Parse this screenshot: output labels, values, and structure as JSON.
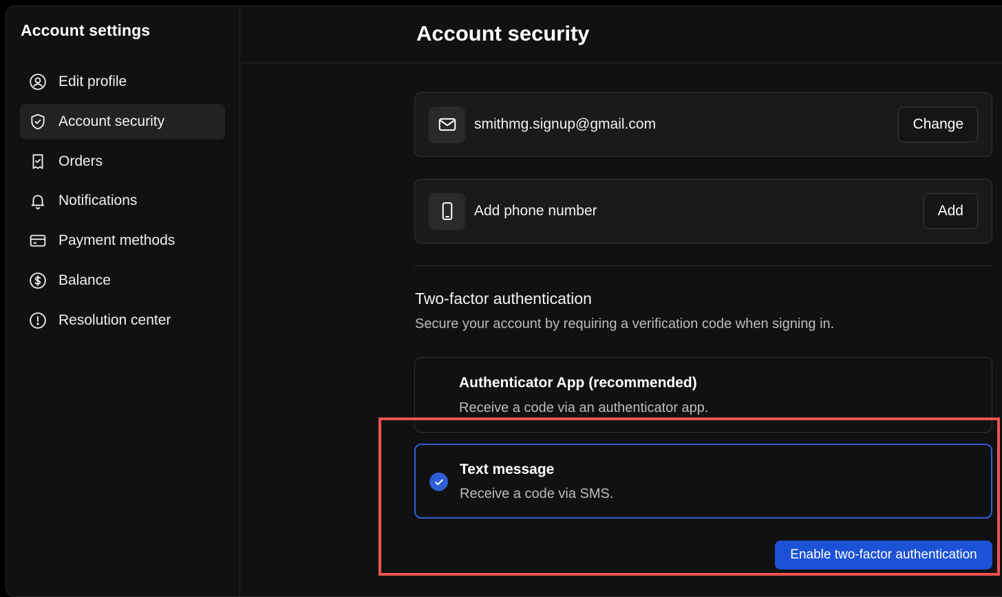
{
  "sidebar": {
    "title": "Account settings",
    "items": [
      {
        "label": "Edit profile",
        "icon": "user-circle-icon",
        "active": false
      },
      {
        "label": "Account security",
        "icon": "shield-icon",
        "active": true
      },
      {
        "label": "Orders",
        "icon": "receipt-icon",
        "active": false
      },
      {
        "label": "Notifications",
        "icon": "bell-icon",
        "active": false
      },
      {
        "label": "Payment methods",
        "icon": "credit-card-icon",
        "active": false
      },
      {
        "label": "Balance",
        "icon": "dollar-circle-icon",
        "active": false
      },
      {
        "label": "Resolution center",
        "icon": "alert-circle-icon",
        "active": false
      }
    ]
  },
  "main": {
    "title": "Account security",
    "email": {
      "value": "smithmg.signup@gmail.com",
      "button": "Change",
      "icon": "mail-icon"
    },
    "phone": {
      "value": "Add phone number",
      "button": "Add",
      "icon": "phone-icon"
    },
    "two_factor": {
      "title": "Two-factor authentication",
      "subtitle": "Secure your account by requiring a verification code when signing in.",
      "options": [
        {
          "title": "Authenticator App (recommended)",
          "description": "Receive a code via an authenticator app.",
          "selected": false
        },
        {
          "title": "Text message",
          "description": "Receive a code via SMS.",
          "selected": true
        }
      ],
      "enable_button": "Enable two-factor authentication"
    }
  },
  "colors": {
    "background": "#111111",
    "accent": "#1d52d6",
    "highlight": "#ef5350"
  }
}
